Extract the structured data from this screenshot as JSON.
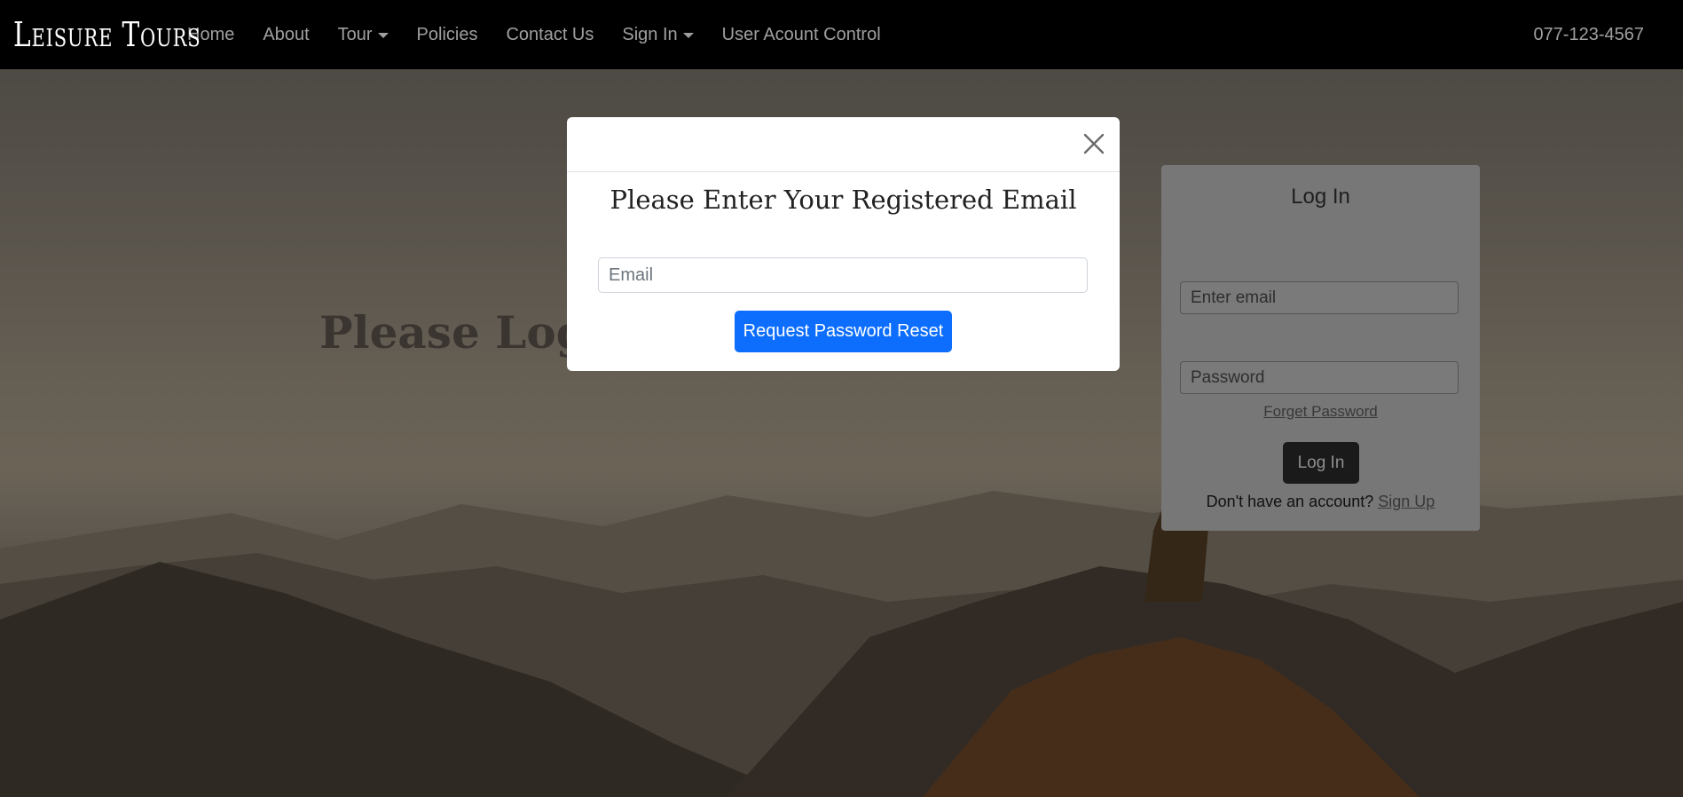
{
  "navbar": {
    "brand": "Leisure Tours",
    "links": [
      {
        "label": "Home"
      },
      {
        "label": "About"
      },
      {
        "label": "Tour"
      },
      {
        "label": "Policies"
      },
      {
        "label": "Contact Us"
      },
      {
        "label": "Sign In"
      },
      {
        "label": "User Acount Control"
      }
    ],
    "phone": "077-123-4567"
  },
  "hero": {
    "title": "Please Login"
  },
  "login_card": {
    "title": "Log In",
    "email_placeholder": "Enter email",
    "password_placeholder": "Password",
    "forget_password": "Forget Password",
    "login_button": "Log In",
    "no_account_text": "Don't have an account?",
    "signup_link": "Sign Up"
  },
  "modal": {
    "title": "Please Enter Your Registered Email",
    "email_placeholder": "Email",
    "submit_button": "Request Password Reset",
    "close_icon": "close-icon"
  }
}
